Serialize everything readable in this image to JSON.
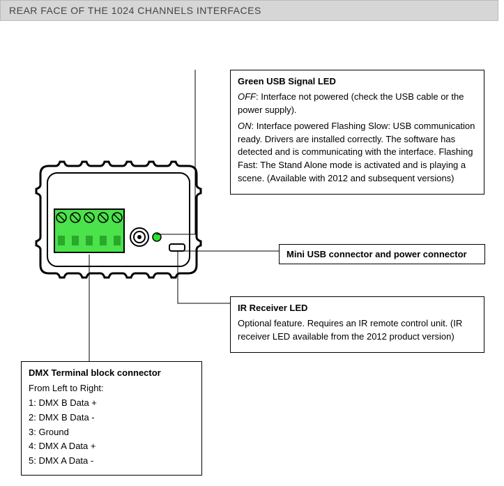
{
  "header": {
    "title": "REAR FACE OF THE 1024 CHANNELS INTERFACES"
  },
  "callouts": {
    "usbLed": {
      "title": "Green USB Signal LED",
      "offLabel": "OFF",
      "offText": ": Interface not powered (check the USB cable or the power supply).",
      "onLabel": "ON",
      "onText": ": Interface powered Flashing Slow: USB communication ready. Drivers are installed correctly. The software has detected and is communicating with the interface. Flashing Fast: The Stand Alone mode is activated and is playing a scene. (Available with 2012 and subsequent versions)"
    },
    "miniUsb": {
      "title": "Mini USB connector and power connector"
    },
    "irLed": {
      "title": "IR Receiver LED",
      "text": "Optional feature.  Requires an IR remote control unit. (IR receiver LED available from the 2012 product version)"
    },
    "dmx": {
      "title": "DMX Terminal block connector",
      "intro": "From Left to Right:",
      "pins": [
        "1: DMX B Data +",
        "2: DMX B Data -",
        "3: Ground",
        "4: DMX A Data +",
        "5: DMX A Data -"
      ]
    }
  }
}
